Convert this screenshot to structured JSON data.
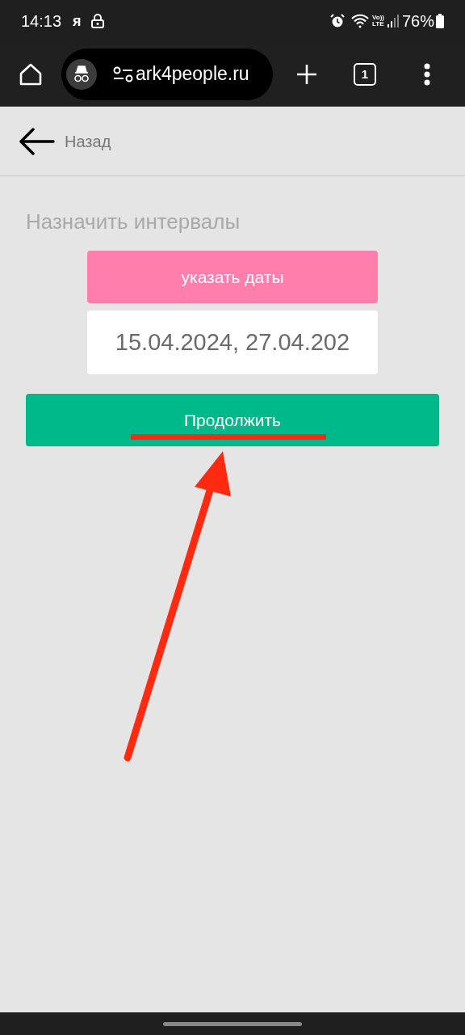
{
  "status_bar": {
    "time": "14:13",
    "notification": "я",
    "volte": "Vo))",
    "network": "LTE",
    "battery": "76%"
  },
  "browser": {
    "url": "ark4people.ru",
    "tab_count": "1"
  },
  "page": {
    "back_label": "Назад",
    "title": "Назначить интервалы",
    "date_button": "указать даты",
    "date_value": "15.04.2024, 27.04.202",
    "continue_button": "Продолжить"
  }
}
